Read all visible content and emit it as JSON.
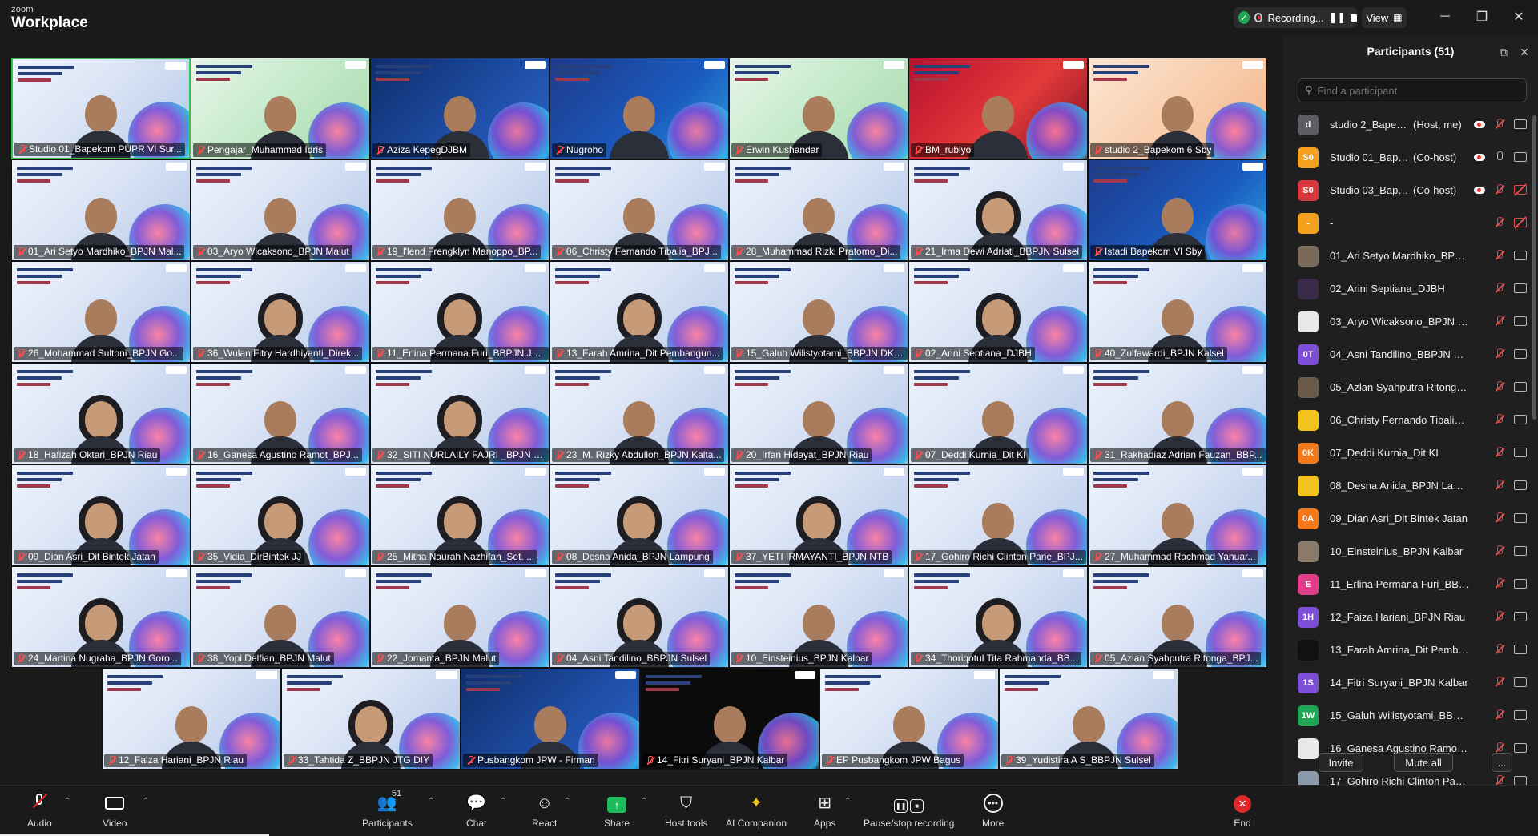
{
  "window": {
    "brand_top": "zoom",
    "brand_bottom": "Workplace",
    "recording_label": "Recording...",
    "view_label": "View"
  },
  "gallery": {
    "rows": [
      [
        {
          "name": "Studio 01_Bapekom PUPR VI Sur...",
          "theme": "light",
          "active": true,
          "mic_off": false,
          "banner": "PELATIHAN PERENCANAAN JALAN BERKESEL..."
        },
        {
          "name": "Pengajar_Muhammad Idris",
          "theme": "green",
          "mic_off": false
        },
        {
          "name": "Aziza KepegDJBM",
          "theme": "dark",
          "mic_off": false
        },
        {
          "name": "Nugroho",
          "theme": "blue2",
          "mic_off": false
        },
        {
          "name": "Erwin Kushandar",
          "theme": "green",
          "mic_off": false
        },
        {
          "name": "BM_rubiyo",
          "theme": "red",
          "mic_off": false
        },
        {
          "name": "studio 2_Bapekom 6 Sby",
          "theme": "warm",
          "mic_off": false
        }
      ],
      [
        {
          "name": "01_Ari Setyo Mardhiko_BPJN Mal...",
          "theme": "light",
          "mic_off": true
        },
        {
          "name": "03_Aryo Wicaksono_BPJN Malut",
          "theme": "light",
          "mic_off": true
        },
        {
          "name": "19_l'lend Frengklyn Manoppo_BP...",
          "theme": "light",
          "mic_off": true
        },
        {
          "name": "06_Christy Fernando Tibalia_BPJ...",
          "theme": "light",
          "mic_off": true
        },
        {
          "name": "28_Muhammad Rizki Pratomo_Di...",
          "theme": "light",
          "mic_off": true
        },
        {
          "name": "21_Irma Dewi Adriati_BBPJN Sulsel",
          "theme": "light",
          "mic_off": true,
          "hijab": true
        },
        {
          "name": "Istadi Bapekom VI Sby",
          "theme": "blue2",
          "mic_off": true
        }
      ],
      [
        {
          "name": "26_Mohammad Sultoni_BPJN Go...",
          "theme": "light",
          "mic_off": true
        },
        {
          "name": "36_Wulan Fitry Hardhiyanti_Direk...",
          "theme": "light",
          "mic_off": true,
          "hijab": true
        },
        {
          "name": "11_Erlina Permana Furi_BBPJN JA...",
          "theme": "light",
          "mic_off": true,
          "hijab": true
        },
        {
          "name": "13_Farah Amrina_Dit Pembangun...",
          "theme": "light",
          "mic_off": true,
          "hijab": true
        },
        {
          "name": "15_Galuh Wilistyotami_BBPJN DKI...",
          "theme": "light",
          "mic_off": true
        },
        {
          "name": "02_Arini Septiana_DJBH",
          "theme": "light",
          "mic_off": true,
          "hijab": true
        },
        {
          "name": "40_Zulfawardi_BPJN Kalsel",
          "theme": "light",
          "mic_off": true
        }
      ],
      [
        {
          "name": "18_Hafizah Oktari_BPJN Riau",
          "theme": "light",
          "mic_off": true,
          "hijab": true
        },
        {
          "name": "16_Ganesa Agustino Ramot_BPJ...",
          "theme": "light",
          "mic_off": true
        },
        {
          "name": "32_SITI NURLAILY FAJRI _BPJN NTB",
          "theme": "light",
          "mic_off": true,
          "hijab": true
        },
        {
          "name": "23_M. Rizky Abdulloh_BPJN Kalta...",
          "theme": "light",
          "mic_off": true
        },
        {
          "name": "20_Irfan Hidayat_BPJN Riau",
          "theme": "light",
          "mic_off": true
        },
        {
          "name": "07_Deddi Kurnia_Dit KI",
          "theme": "light",
          "mic_off": true
        },
        {
          "name": "31_Rakhadiaz Adrian Fauzan_BBP...",
          "theme": "light",
          "mic_off": true
        }
      ],
      [
        {
          "name": "09_Dian Asri_Dit Bintek Jatan",
          "theme": "light",
          "mic_off": true,
          "hijab": true
        },
        {
          "name": "35_Vidia_DirBintek JJ",
          "theme": "light",
          "mic_off": true,
          "hijab": true
        },
        {
          "name": "25_Mitha Naurah Nazhifah_Set. ...",
          "theme": "light",
          "mic_off": true,
          "hijab": true
        },
        {
          "name": "08_Desna Anida_BPJN Lampung",
          "theme": "light",
          "mic_off": true,
          "hijab": true
        },
        {
          "name": "37_YETI IRMAYANTI_BPJN NTB",
          "theme": "light",
          "mic_off": true,
          "hijab": true
        },
        {
          "name": "17_Gohiro Richi Clinton Pane_BPJ...",
          "theme": "light",
          "mic_off": true
        },
        {
          "name": "27_Muhammad Rachmad Yanuar...",
          "theme": "light",
          "mic_off": true
        }
      ],
      [
        {
          "name": "24_Martina Nugraha_BPJN Goro...",
          "theme": "light",
          "mic_off": true,
          "hijab": true
        },
        {
          "name": "38_Yopi Delfian_BPJN Malut",
          "theme": "light",
          "mic_off": true
        },
        {
          "name": "22_Jomanta_BPJN Malut",
          "theme": "light",
          "mic_off": true
        },
        {
          "name": "04_Asni Tandilino_BBPJN Sulsel",
          "theme": "light",
          "mic_off": true,
          "hijab": true
        },
        {
          "name": "10_Einsteinius_BPJN Kalbar",
          "theme": "light",
          "mic_off": true
        },
        {
          "name": "34_Thoriqotul Tita Rahmanda_BB...",
          "theme": "light",
          "mic_off": true,
          "hijab": true
        },
        {
          "name": "05_Azlan Syahputra Ritonga_BPJ...",
          "theme": "light",
          "mic_off": true
        }
      ],
      [
        {
          "name": "12_Faiza Hariani_BPJN Riau",
          "theme": "light",
          "mic_off": true
        },
        {
          "name": "33_Tahtida Z_BBPJN JTG DIY",
          "theme": "light",
          "mic_off": true,
          "hijab": true
        },
        {
          "name": "Pusbangkom JPW - Firman",
          "theme": "dark",
          "mic_off": true
        },
        {
          "name": "14_Fitri Suryani_BPJN Kalbar",
          "theme": "black",
          "mic_off": true
        },
        {
          "name": "EP Pusbangkom JPW Bagus",
          "theme": "light",
          "mic_off": true
        },
        {
          "name": "39_Yudistira A S_BBPJN Sulsel",
          "theme": "light",
          "mic_off": true
        }
      ]
    ]
  },
  "participants_panel": {
    "title": "Participants (51)",
    "search_placeholder": "Find a participant",
    "invite_label": "Invite",
    "mute_all_label": "Mute all",
    "more_label": "...",
    "items": [
      {
        "avatar": "d",
        "color": "#5d5d66",
        "name": "studio 2_Bapek...",
        "tag": "(Host, me)",
        "mic_off": true,
        "video_off": false,
        "cloud": true
      },
      {
        "avatar": "S0",
        "color": "#f2a01d",
        "name": "Studio 01_Bapek...",
        "tag": "(Co-host)",
        "mic_off": false,
        "video_off": false,
        "cloud": true
      },
      {
        "avatar": "S0",
        "color": "#d9363e",
        "name": "Studio 03_Bapekom ...",
        "tag": "(Co-host)",
        "mic_off": true,
        "video_off": true,
        "cloud": true
      },
      {
        "avatar": "-",
        "color": "#f2a01d",
        "name": "-",
        "tag": "",
        "mic_off": true,
        "video_off": true
      },
      {
        "avatar": "",
        "color": "#7a6a5a",
        "name": "01_Ari Setyo Mardhiko_BPJN M...",
        "tag": "",
        "mic_off": true,
        "video_off": false
      },
      {
        "avatar": "",
        "color": "#3a2a4a",
        "name": "02_Arini Septiana_DJBH",
        "tag": "",
        "mic_off": true,
        "video_off": false
      },
      {
        "avatar": "",
        "color": "#e8e8e8",
        "name": "03_Aryo Wicaksono_BPJN Malut",
        "tag": "",
        "mic_off": true,
        "video_off": false
      },
      {
        "avatar": "0T",
        "color": "#7d4fd6",
        "name": "04_Asni Tandilino_BBPJN Sulsel",
        "tag": "",
        "mic_off": true,
        "video_off": false
      },
      {
        "avatar": "",
        "color": "#6a5a4a",
        "name": "05_Azlan Syahputra Ritonga_BP...",
        "tag": "",
        "mic_off": true,
        "video_off": false
      },
      {
        "avatar": "",
        "color": "#f2c21d",
        "name": "06_Christy Fernando Tibalia_BPJ...",
        "tag": "",
        "mic_off": true,
        "video_off": false
      },
      {
        "avatar": "0K",
        "color": "#f27a1d",
        "name": "07_Deddi Kurnia_Dit KI",
        "tag": "",
        "mic_off": true,
        "video_off": false
      },
      {
        "avatar": "",
        "color": "#f2c21d",
        "name": "08_Desna Anida_BPJN Lampung",
        "tag": "",
        "mic_off": true,
        "video_off": false
      },
      {
        "avatar": "0A",
        "color": "#f27a1d",
        "name": "09_Dian Asri_Dit Bintek Jatan",
        "tag": "",
        "mic_off": true,
        "video_off": false
      },
      {
        "avatar": "",
        "color": "#8a7a6a",
        "name": "10_Einsteinius_BPJN Kalbar",
        "tag": "",
        "mic_off": true,
        "video_off": false
      },
      {
        "avatar": "E",
        "color": "#e23d8a",
        "name": "11_Erlina Permana Furi_BBPJN J...",
        "tag": "",
        "mic_off": true,
        "video_off": false
      },
      {
        "avatar": "1H",
        "color": "#7d4fd6",
        "name": "12_Faiza Hariani_BPJN Riau",
        "tag": "",
        "mic_off": true,
        "video_off": false
      },
      {
        "avatar": "",
        "color": "#111111",
        "name": "13_Farah Amrina_Dit Pembang...",
        "tag": "",
        "mic_off": true,
        "video_off": false
      },
      {
        "avatar": "1S",
        "color": "#7d4fd6",
        "name": "14_Fitri Suryani_BPJN Kalbar",
        "tag": "",
        "mic_off": true,
        "video_off": false
      },
      {
        "avatar": "1W",
        "color": "#1fa653",
        "name": "15_Galuh Wilistyotami_BBPJN D...",
        "tag": "",
        "mic_off": true,
        "video_off": false
      },
      {
        "avatar": "",
        "color": "#e8e8e8",
        "name": "16_Ganesa Agustino Ramot_BPJ...",
        "tag": "",
        "mic_off": true,
        "video_off": false
      },
      {
        "avatar": "",
        "color": "#8a9aaa",
        "name": "17_Gohiro Richi Clinton Pane_B...",
        "tag": "",
        "mic_off": true,
        "video_off": false
      }
    ]
  },
  "toolbar": {
    "audio": "Audio",
    "video": "Video",
    "participants": "Participants",
    "participants_count": "51",
    "chat": "Chat",
    "react": "React",
    "share": "Share",
    "host_tools": "Host tools",
    "ai_companion": "AI Companion",
    "apps": "Apps",
    "pause_stop": "Pause/stop recording",
    "more": "More",
    "end": "End"
  }
}
